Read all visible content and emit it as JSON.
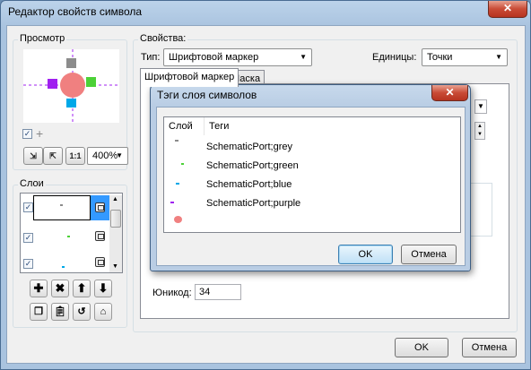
{
  "window": {
    "title": "Редактор свойств символа",
    "close_glyph": "✕"
  },
  "preview": {
    "label": "Просмотр",
    "zoom_value": "400%",
    "btn_fit_label": "1:1"
  },
  "layers": {
    "label": "Слои",
    "items": [
      {
        "checked": true,
        "color": "#8c8c8c"
      },
      {
        "checked": true,
        "color": "#4cd137"
      },
      {
        "checked": true,
        "color": "#00a8e8"
      }
    ]
  },
  "properties": {
    "label": "Свойства:",
    "type_label": "Тип:",
    "type_value": "Шрифтовой маркер",
    "units_label": "Единицы:",
    "units_value": "Точки",
    "tabs": [
      "Шрифтовой маркер",
      "Маска"
    ],
    "unicode_label": "Юникод:",
    "unicode_value": "34"
  },
  "buttons": {
    "ok": "OK",
    "cancel": "Отмена"
  },
  "tags_dialog": {
    "title": "Тэги слоя символов",
    "close_glyph": "✕",
    "columns": [
      "Слой",
      "Теги"
    ],
    "rows": [
      {
        "tag": "SchematicPort;grey",
        "color": "#8c8c8c"
      },
      {
        "tag": "SchematicPort;green",
        "color": "#4cd137"
      },
      {
        "tag": "SchematicPort;blue",
        "color": "#00a8e8"
      },
      {
        "tag": "SchematicPort;purple",
        "color": "#a020f0"
      },
      {
        "tag": "",
        "color": "#f08080"
      }
    ],
    "ok": "OK",
    "cancel": "Отмена"
  },
  "colors": {
    "grey": "#8c8c8c",
    "green": "#4cd137",
    "blue": "#00a8e8",
    "purple": "#a020f0",
    "salmon": "#f08080",
    "selection": "#3399ff"
  }
}
